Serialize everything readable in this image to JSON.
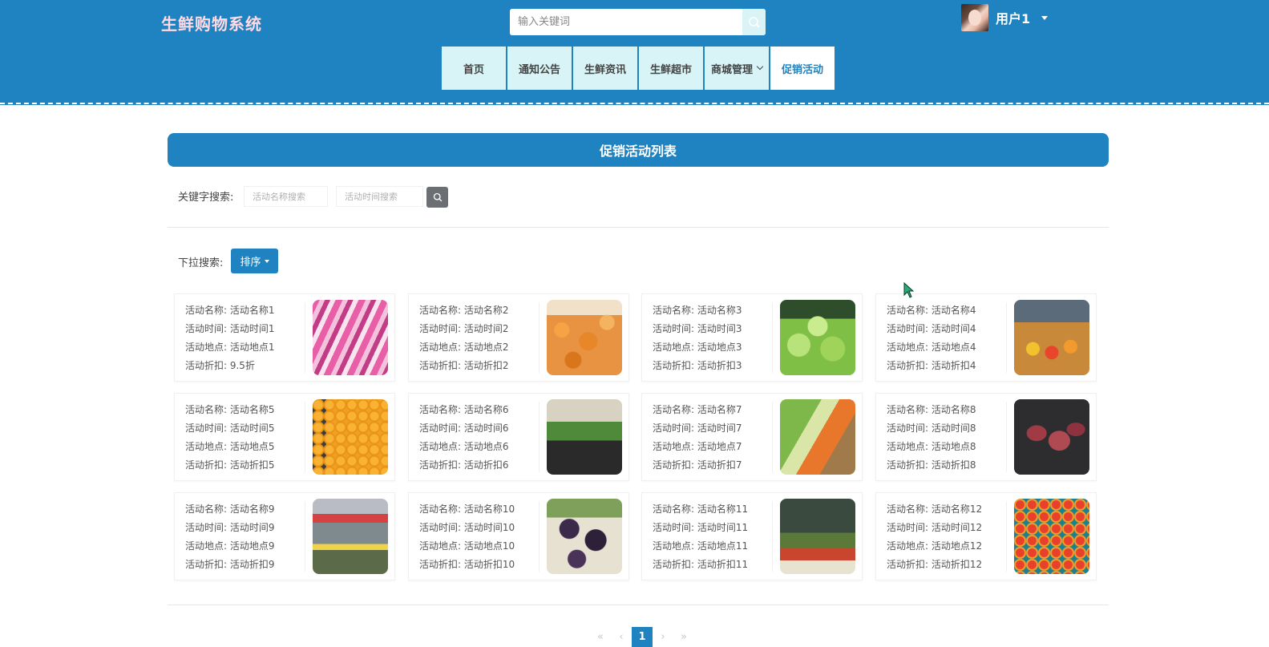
{
  "header": {
    "site_title": "生鲜购物系统",
    "search_placeholder": "输入关键词",
    "user_name": "用户1",
    "bg_color": "#2083c1"
  },
  "nav": {
    "items": [
      {
        "label": "首页"
      },
      {
        "label": "通知公告"
      },
      {
        "label": "生鲜资讯"
      },
      {
        "label": "生鲜超市"
      },
      {
        "label": "商城管理"
      },
      {
        "label": "促销活动"
      }
    ],
    "active": "促销活动"
  },
  "main": {
    "list_title": "促销活动列表",
    "keyword_label": "关键字搜索:",
    "name_placeholder": "活动名称搜索",
    "time_placeholder": "活动时间搜索",
    "dropdown_label": "下拉搜索:",
    "sort_label": "排序"
  },
  "cards": [
    {
      "name": "活动名称: 活动名称1",
      "time": "活动时间: 活动时间1",
      "place": "活动地点: 活动地点1",
      "discount": "活动折扣: 9.5折",
      "image": "meat-packs"
    },
    {
      "name": "活动名称: 活动名称2",
      "time": "活动时间: 活动时间2",
      "place": "活动地点: 活动地点2",
      "discount": "活动折扣: 活动折扣2",
      "image": "oranges"
    },
    {
      "name": "活动名称: 活动名称3",
      "time": "活动时间: 活动时间3",
      "place": "活动地点: 活动地点3",
      "discount": "活动折扣: 活动折扣3",
      "image": "lettuce"
    },
    {
      "name": "活动名称: 活动名称4",
      "time": "活动时间: 活动时间4",
      "place": "活动地点: 活动地点4",
      "discount": "活动折扣: 活动折扣4",
      "image": "produce-aisle"
    },
    {
      "name": "活动名称: 活动名称5",
      "time": "活动时间: 活动时间5",
      "place": "活动地点: 活动地点5",
      "discount": "活动折扣: 活动折扣5",
      "image": "oranges-pile"
    },
    {
      "name": "活动名称: 活动名称6",
      "time": "活动时间: 活动时间6",
      "place": "活动地点: 活动地点6",
      "discount": "活动折扣: 活动折扣6",
      "image": "supermarket"
    },
    {
      "name": "活动名称: 活动名称7",
      "time": "活动时间: 活动时间7",
      "place": "活动地点: 活动地点7",
      "discount": "活动折扣: 活动折扣7",
      "image": "vegetables"
    },
    {
      "name": "活动名称: 活动名称8",
      "time": "活动时间: 活动时间8",
      "place": "活动地点: 活动地点8",
      "discount": "活动折扣: 活动折扣8",
      "image": "steaks"
    },
    {
      "name": "活动名称: 活动名称9",
      "time": "活动时间: 活动时间9",
      "place": "活动地点: 活动地点9",
      "discount": "活动折扣: 活动折扣9",
      "image": "store-interior"
    },
    {
      "name": "活动名称: 活动名称10",
      "time": "活动时间: 活动时间10",
      "place": "活动地点: 活动地点10",
      "discount": "活动折扣: 活动折扣10",
      "image": "grapes"
    },
    {
      "name": "活动名称: 活动名称11",
      "time": "活动时间: 活动时间11",
      "place": "活动地点: 活动地点11",
      "discount": "活动折扣: 活动折扣11",
      "image": "market-stall"
    },
    {
      "name": "活动名称: 活动名称12",
      "time": "活动时间: 活动时间12",
      "place": "活动地点: 活动地点12",
      "discount": "活动折扣: 活动折扣12",
      "image": "tomatoes"
    }
  ],
  "pagination": {
    "first": "«",
    "prev": "‹",
    "current": "1",
    "next": "›",
    "last": "»"
  }
}
